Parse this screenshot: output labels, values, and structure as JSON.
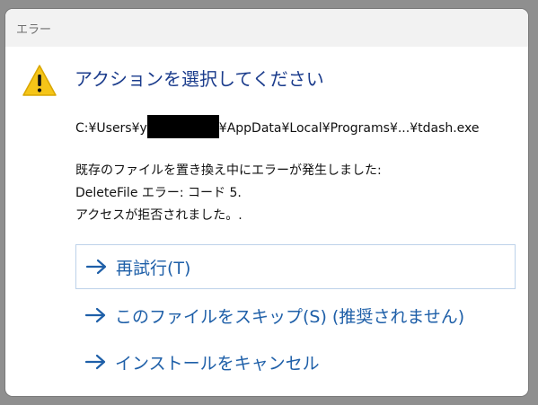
{
  "window": {
    "title": "エラー"
  },
  "icons": {
    "warning": "warning-triangle-icon",
    "arrow": "right-arrow-icon"
  },
  "colors": {
    "heading": "#1b3c8c",
    "option_text": "#1e5fa8",
    "warning_fill": "#f5c518"
  },
  "dialog": {
    "heading": "アクションを選択してください",
    "path_prefix": "C:¥Users¥y",
    "path_suffix": "¥AppData¥Local¥Programs¥...¥tdash.exe",
    "message_lines": [
      "既存のファイルを置き換え中にエラーが発生しました:",
      "DeleteFile エラー: コード 5.",
      "アクセスが拒否されました。."
    ],
    "options": [
      {
        "label": "再試行(T)"
      },
      {
        "label": "このファイルをスキップ(S) (推奨されません)"
      },
      {
        "label": "インストールをキャンセル"
      }
    ]
  }
}
